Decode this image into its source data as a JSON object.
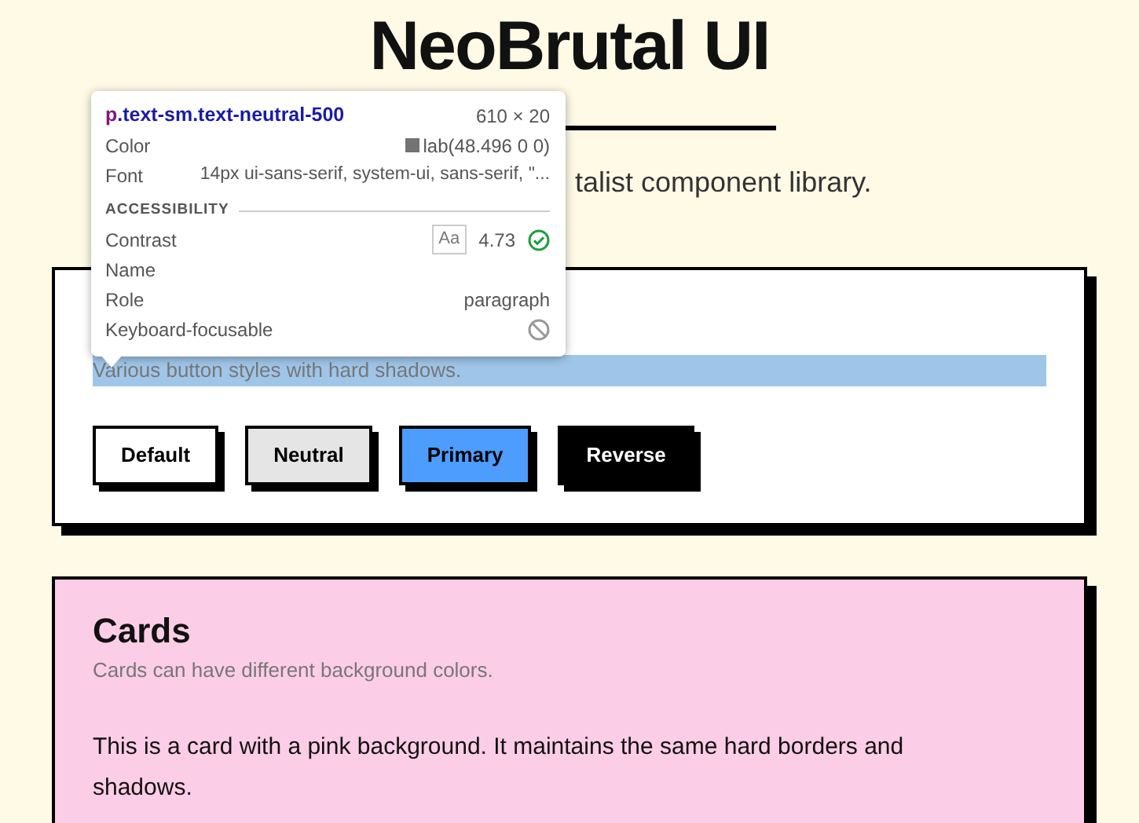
{
  "page": {
    "title": "NeoBrutal UI",
    "subtitle": "talist component library."
  },
  "sections": [
    {
      "kind": "buttons",
      "description": "Various button styles with hard shadows.",
      "highlighted": true,
      "buttons": [
        {
          "label": "Default",
          "kind": "default"
        },
        {
          "label": "Neutral",
          "kind": "neutral"
        },
        {
          "label": "Primary",
          "kind": "primary"
        },
        {
          "label": "Reverse",
          "kind": "reverse"
        }
      ]
    },
    {
      "kind": "card",
      "color": "#fccde6",
      "title": "Cards",
      "description": "Cards can have different background colors.",
      "body": "This is a card with a pink background. It maintains the same hard borders and shadows."
    }
  ],
  "inspector": {
    "tag": "p",
    "classes": ".text-sm.text-neutral-500",
    "size": "610 × 20",
    "rows": [
      {
        "label": "Color",
        "value": "lab(48.496 0 0)",
        "kind": "color"
      },
      {
        "label": "Font",
        "value": "14px ui-sans-serif, system-ui, sans-serif, \"...",
        "kind": "text"
      }
    ],
    "section_title": "ACCESSIBILITY",
    "contrast": {
      "label": "Contrast",
      "sample": "Aa",
      "ratio": "4.73",
      "passes": true
    },
    "name": {
      "label": "Name"
    },
    "role": {
      "label": "Role",
      "value": "paragraph"
    },
    "keyboard": {
      "label": "Keyboard-focusable",
      "focusable": false
    }
  }
}
